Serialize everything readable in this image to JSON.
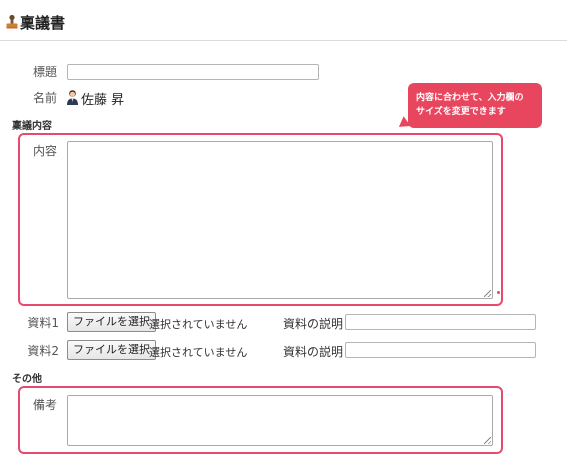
{
  "header": {
    "title": "稟議書",
    "icon": "approval-stamp-icon"
  },
  "form": {
    "subject_label": "標題",
    "subject_value": "",
    "name_label": "名前",
    "applicant_name": "佐藤 昇",
    "section_content": "稟議内容",
    "content_label": "内容",
    "content_value": "",
    "attachments": [
      {
        "label": "資料1",
        "button_label": "ファイルを選択",
        "status": "選択されていません",
        "desc_label": "資料の説明",
        "desc_value": ""
      },
      {
        "label": "資料2",
        "button_label": "ファイルを選択",
        "status": "選択されていません",
        "desc_label": "資料の説明",
        "desc_value": ""
      }
    ],
    "section_other": "その他",
    "remarks_label": "備考",
    "remarks_value": ""
  },
  "tooltip": {
    "line1": "内容に合わせて、入力欄の",
    "line2": "サイズを変更できます"
  },
  "colors": {
    "accent": "#e84a6e",
    "tooltip_bg": "#e8465f"
  }
}
